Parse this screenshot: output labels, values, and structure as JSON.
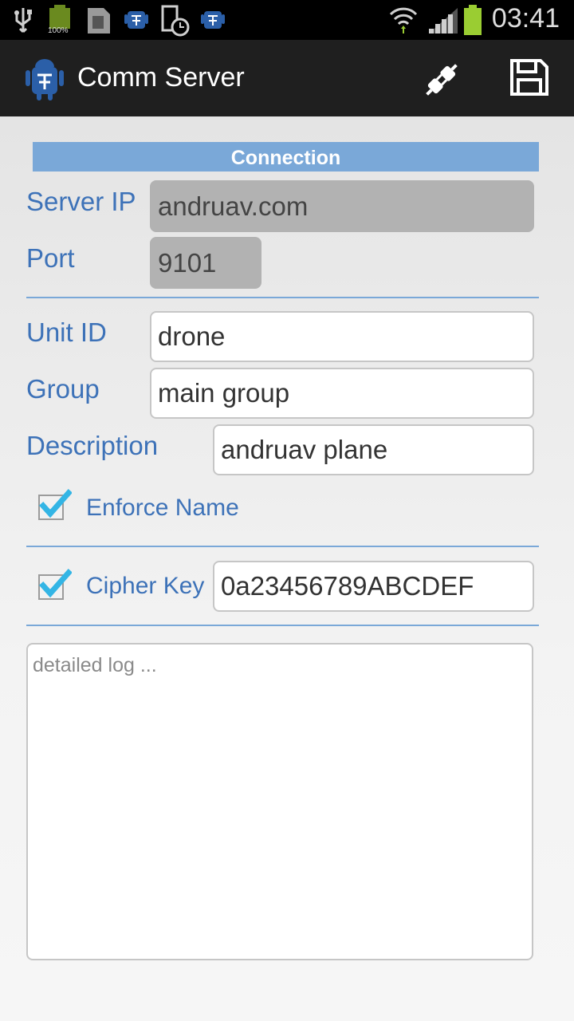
{
  "status_bar": {
    "time": "03:41",
    "battery_text": "100%"
  },
  "action_bar": {
    "title": "Comm Server",
    "actions": [
      "connect-icon",
      "save-icon"
    ]
  },
  "form": {
    "section_header": "Connection",
    "server_ip": {
      "label": "Server IP",
      "value": "andruav.com"
    },
    "port": {
      "label": "Port",
      "value": "9101"
    },
    "unit_id": {
      "label": "Unit ID",
      "value": "drone"
    },
    "group": {
      "label": "Group",
      "value": "main group"
    },
    "description": {
      "label": "Description",
      "value": "andruav plane"
    },
    "enforce_name": {
      "label": "Enforce Name",
      "checked": true
    },
    "cipher_key": {
      "label": "Cipher Key",
      "checked": true,
      "value": "0a23456789ABCDEF"
    },
    "log": {
      "placeholder": "detailed log ..."
    }
  },
  "colors": {
    "accent": "#7aa8d8",
    "label": "#3d72b8",
    "check": "#33b5e5"
  }
}
